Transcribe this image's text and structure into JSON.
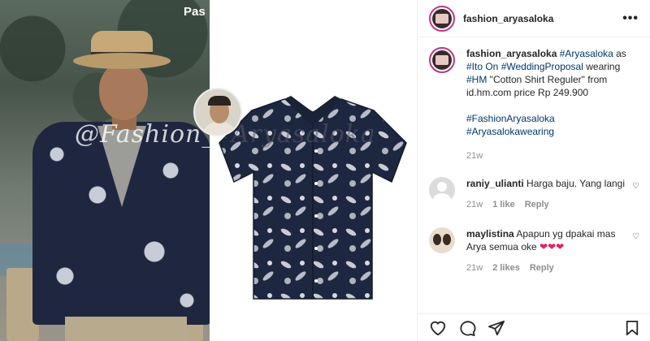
{
  "media": {
    "watermark_partial": "Pas",
    "watermark_left": "@Fashion_",
    "watermark_right": "Aryasaloka"
  },
  "post": {
    "username": "fashion_aryasaloka",
    "caption": {
      "username": "fashion_aryasaloka",
      "tag1": "#Aryasaloka",
      "text1": " as ",
      "tag2": "#Ito On",
      "text2": " ",
      "tag3": "#WeddingProposal",
      "text3": " wearing ",
      "tag4": "#HM",
      "text4": " \"Cotton Shirt Reguler\" from id.hm.com price Rp 249.900",
      "tag5": "#FashionAryasaloka",
      "tag6": "#Aryasalokawearing",
      "age": "21w"
    }
  },
  "comments": [
    {
      "username": "raniy_ulianti",
      "text": "Harga baju. Yang langi",
      "age": "21w",
      "likes": "1 like",
      "reply": "Reply",
      "avatar": "default-avatar"
    },
    {
      "username": "maylistina",
      "text": "Apapun yg dpakai mas Arya semua oke",
      "emoji": "❤❤❤",
      "age": "21w",
      "likes": "2 likes",
      "reply": "Reply",
      "avatar": "user-photo-avatar"
    }
  ],
  "icons": {
    "more": "more-options-icon",
    "like": "heart-icon",
    "comment": "comment-icon",
    "share": "paper-plane-icon",
    "save": "bookmark-icon"
  },
  "colors": {
    "hashtag": "#00376b",
    "meta": "#8e8e8e",
    "heart_emoji": "#e0245e",
    "story_ring": "#c13584"
  }
}
